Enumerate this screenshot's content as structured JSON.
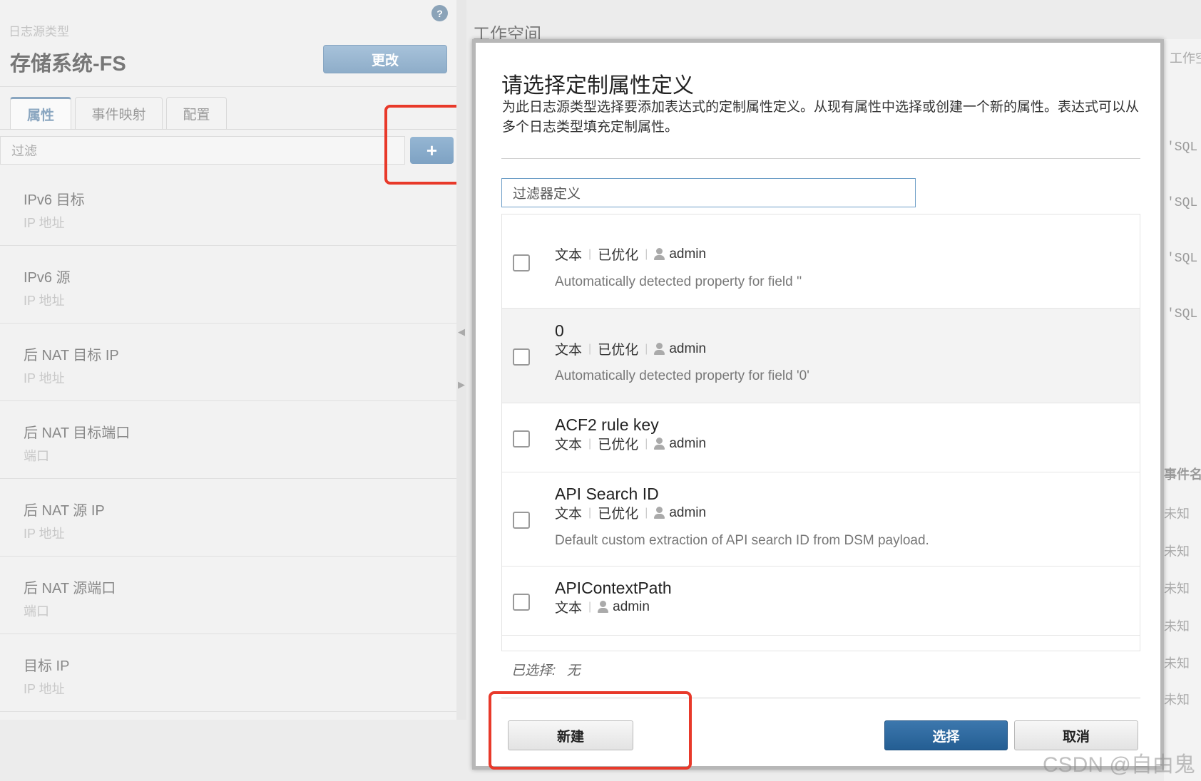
{
  "left_panel": {
    "help_icon": "?",
    "log_source_type_label": "日志源类型",
    "log_source_type_name": "存储系统-FS",
    "change_button": "更改",
    "tabs": [
      {
        "label": "属性",
        "active": true
      },
      {
        "label": "事件映射",
        "active": false
      },
      {
        "label": "配置",
        "active": false
      }
    ],
    "filter_placeholder": "过滤",
    "add_button": "+",
    "properties": [
      {
        "name": "IPv6 目标",
        "type": "IP 地址"
      },
      {
        "name": "IPv6 源",
        "type": "IP 地址"
      },
      {
        "name": "后 NAT 目标 IP",
        "type": "IP 地址"
      },
      {
        "name": "后 NAT 目标端口",
        "type": "端口"
      },
      {
        "name": "后 NAT 源 IP",
        "type": "IP 地址"
      },
      {
        "name": "后 NAT 源端口",
        "type": "端口"
      },
      {
        "name": "目标 IP",
        "type": "IP 地址"
      }
    ]
  },
  "background": {
    "workspace_title": "工作空间",
    "right_header": "工作空",
    "sql_snippets": [
      "'SQL",
      "'SQL",
      "'SQL",
      "'SQL"
    ],
    "event_name_header": "事件名",
    "unknown_cells": [
      "未知",
      "未知",
      "未知",
      "未知",
      "未知",
      "未知"
    ]
  },
  "dialog": {
    "title": "请选择定制属性定义",
    "description": "为此日志源类型选择要添加表达式的定制属性定义。从现有属性中选择或创建一个新的属性。表达式可以从多个日志类型填充定制属性。",
    "filter_placeholder": "过滤器定义",
    "definitions": [
      {
        "name": "",
        "type": "文本",
        "optimized": "已优化",
        "owner": "admin",
        "description": "Automatically detected property for field ''"
      },
      {
        "name": "0",
        "type": "文本",
        "optimized": "已优化",
        "owner": "admin",
        "description": "Automatically detected property for field '0'"
      },
      {
        "name": "ACF2 rule key",
        "type": "文本",
        "optimized": "已优化",
        "owner": "admin",
        "description": ""
      },
      {
        "name": "API Search ID",
        "type": "文本",
        "optimized": "已优化",
        "owner": "admin",
        "description": "Default custom extraction of API search ID from DSM payload."
      },
      {
        "name": "APIContextPath",
        "type": "文本",
        "optimized": "",
        "owner": "admin",
        "description": ""
      }
    ],
    "selected_label": "已选择:",
    "selected_value": "无",
    "new_button": "新建",
    "select_button": "选择",
    "cancel_button": "取消"
  },
  "watermark": "CSDN @自由鬼",
  "colors": {
    "highlight": "#e8392a",
    "primary_button": "#2c6a9f",
    "secondary_button_accent": "#8aa6c0"
  }
}
